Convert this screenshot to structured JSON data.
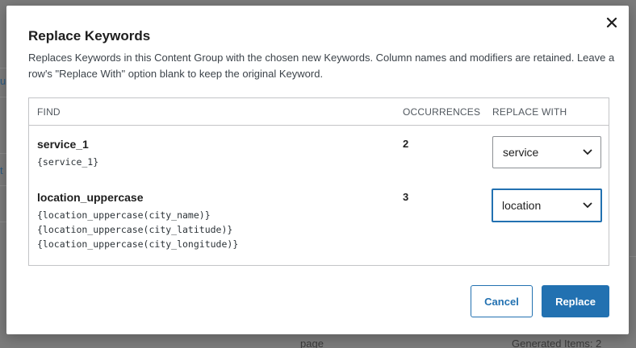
{
  "background": {
    "left_fragments": [
      "u",
      "t"
    ],
    "bottom_left": "page",
    "bottom_right": "Generated Items: 2"
  },
  "modal": {
    "title": "Replace Keywords",
    "description": "Replaces Keywords in this Content Group with the chosen new Keywords. Column names and modifiers are retained. Leave a row's \"Replace With\" option blank to keep the original Keyword.",
    "close_icon": "close-icon",
    "table": {
      "headers": {
        "find": "FIND",
        "occurrences": "OCCURRENCES",
        "replace_with": "REPLACE WITH"
      },
      "rows": [
        {
          "keyword": "service_1",
          "usages": [
            "{service_1}"
          ],
          "occurrences": "2",
          "replace_value": "service"
        },
        {
          "keyword": "location_uppercase",
          "usages": [
            "{location_uppercase(city_name)}",
            "{location_uppercase(city_latitude)}",
            "{location_uppercase(city_longitude)}"
          ],
          "occurrences": "3",
          "replace_value": "location"
        }
      ]
    },
    "buttons": {
      "cancel": "Cancel",
      "replace": "Replace"
    }
  },
  "colors": {
    "accent": "#2271b1",
    "overlay": "#7b7b7b",
    "border": "#c3c4c7"
  }
}
